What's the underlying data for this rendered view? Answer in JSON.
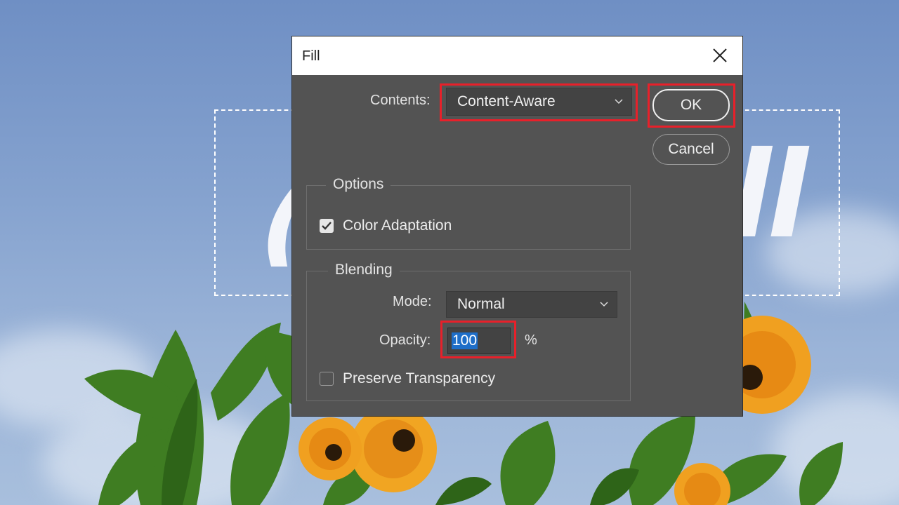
{
  "background": {
    "overlay_text": "C ll"
  },
  "dialog": {
    "title": "Fill",
    "contents": {
      "label": "Contents:",
      "value": "Content-Aware"
    },
    "buttons": {
      "ok": "OK",
      "cancel": "Cancel"
    },
    "options": {
      "title": "Options",
      "color_adaptation": {
        "label": "Color Adaptation",
        "checked": true
      }
    },
    "blending": {
      "title": "Blending",
      "mode": {
        "label": "Mode:",
        "value": "Normal"
      },
      "opacity": {
        "label": "Opacity:",
        "value": "100",
        "unit": "%"
      },
      "preserve_transparency": {
        "label": "Preserve Transparency",
        "checked": false
      }
    }
  },
  "colors": {
    "dialog_bg": "#535353",
    "highlight": "#e8202a",
    "selection_blue": "#1e6ec8"
  }
}
